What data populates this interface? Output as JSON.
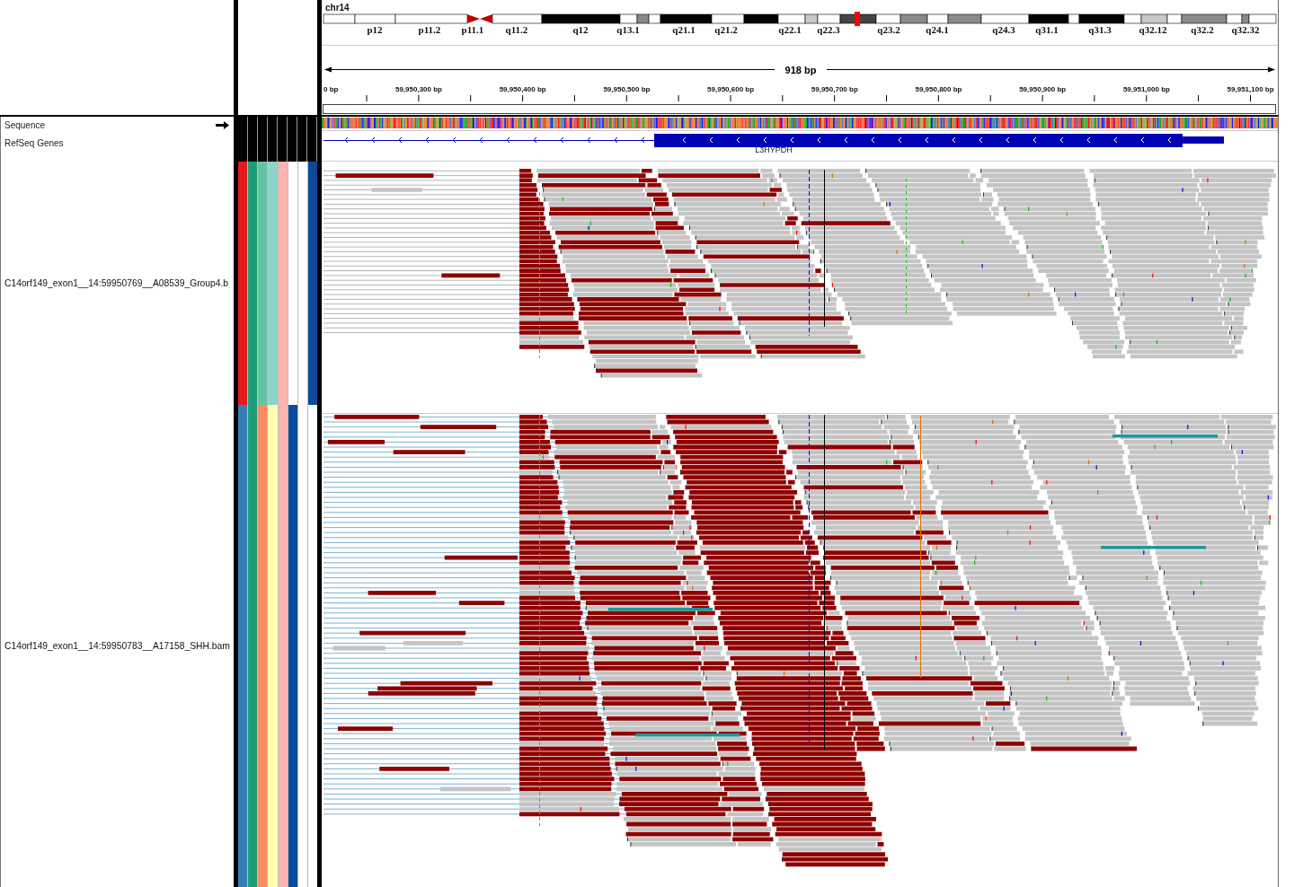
{
  "chromosome": {
    "name": "chr14",
    "bands": [
      "p12",
      "p11.2",
      "p11.1",
      "q11.2",
      "q12",
      "q13.1",
      "q21.1",
      "q21.2",
      "q22.1",
      "q22.3",
      "q23.2",
      "q24.1",
      "q24.3",
      "q31.1",
      "q31.3",
      "q32.12",
      "q32.2",
      "q32.32"
    ]
  },
  "ruler": {
    "span": "918 bp",
    "ticks": [
      "0 bp",
      "59,950,300 bp",
      "59,950,400 bp",
      "59,950,500 bp",
      "59,950,600 bp",
      "59,950,700 bp",
      "59,950,800 bp",
      "59,950,900 bp",
      "59,951,000 bp",
      "59,951,100 bp"
    ]
  },
  "tracks": [
    {
      "kind": "sequence",
      "name": "Sequence"
    },
    {
      "kind": "gene",
      "name": "RefSeq Genes",
      "gene": "L3HYPDH"
    }
  ],
  "samples": [
    {
      "name": "C14orf149_exon1__14:59950769__A08539_Group4.b",
      "attributes": [
        {
          "color": "#e41a1c"
        },
        {
          "color": "#1b9e77"
        },
        {
          "color": "#66c2a5"
        },
        {
          "color": "#8dd3c7"
        },
        {
          "color": "#fbb4ae"
        },
        {
          "color": "#ffffff"
        },
        {
          "color": "#ffffff"
        },
        {
          "color": "#0b4a9b"
        }
      ]
    },
    {
      "name": "C14orf149_exon1__14:59950783__A17158_SHH.bam",
      "attributes": [
        {
          "color": "#377eb8"
        },
        {
          "color": "#1b9e77"
        },
        {
          "color": "#fc8d62"
        },
        {
          "color": "#ffffb3"
        },
        {
          "color": "#fbb4ae"
        },
        {
          "color": "#0b4a9b"
        },
        {
          "color": "#ffffff"
        },
        {
          "color": "#ffffff"
        }
      ]
    }
  ]
}
